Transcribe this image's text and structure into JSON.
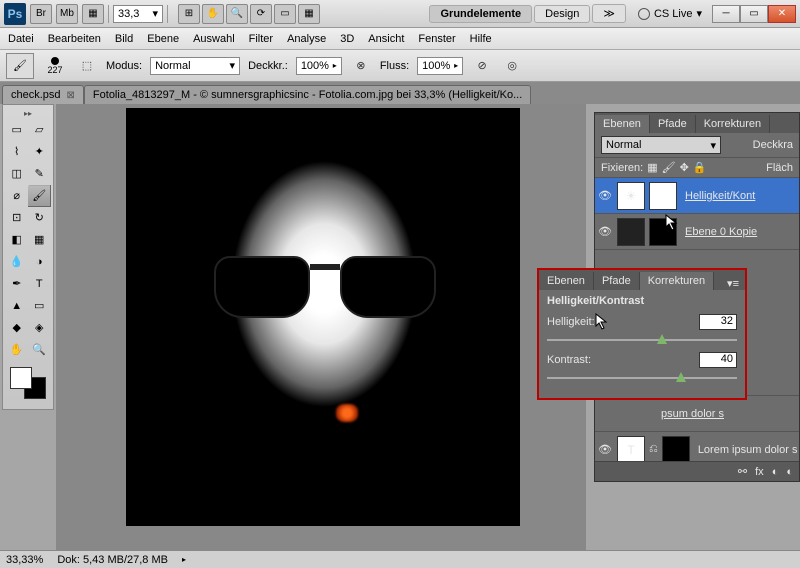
{
  "titlebar": {
    "bridge": "Br",
    "minibridge": "Mb",
    "zoom": "33,3",
    "views": {
      "essential": "Grundelemente",
      "design": "Design"
    },
    "cslive": "CS Live"
  },
  "menu": [
    "Datei",
    "Bearbeiten",
    "Bild",
    "Ebene",
    "Auswahl",
    "Filter",
    "Analyse",
    "3D",
    "Ansicht",
    "Fenster",
    "Hilfe"
  ],
  "options": {
    "brush_size": "227",
    "mode_label": "Modus:",
    "mode": "Normal",
    "opacity_label": "Deckkr.:",
    "opacity": "100%",
    "flow_label": "Fluss:",
    "flow": "100%"
  },
  "doc_tabs": [
    {
      "label": "check.psd"
    },
    {
      "label": "Fotolia_4813297_M - © sumnersgraphicsinc - Fotolia.com.jpg bei 33,3% (Helligkeit/Ko..."
    }
  ],
  "status": {
    "zoom": "33,33%",
    "dok": "Dok: 5,43 MB/27,8 MB"
  },
  "layers_panel": {
    "tabs": [
      "Ebenen",
      "Pfade",
      "Korrekturen"
    ],
    "blend": "Normal",
    "opacity_label": "Deckkra",
    "lock_label": "Fixieren:",
    "fill_label": "Fläch",
    "items": [
      {
        "name": "Helligkeit/Kont"
      },
      {
        "name": "Ebene 0 Kopie"
      },
      {
        "name": "psum dolor s"
      },
      {
        "name": "psum dolor s"
      },
      {
        "name": "Lorem ipsum dolor s"
      }
    ]
  },
  "bc_panel": {
    "tabs": [
      "Ebenen",
      "Pfade",
      "Korrekturen"
    ],
    "title": "Helligkeit/Kontrast",
    "brightness_label": "Helligkeit:",
    "brightness": "32",
    "contrast_label": "Kontrast:",
    "contrast": "40"
  }
}
